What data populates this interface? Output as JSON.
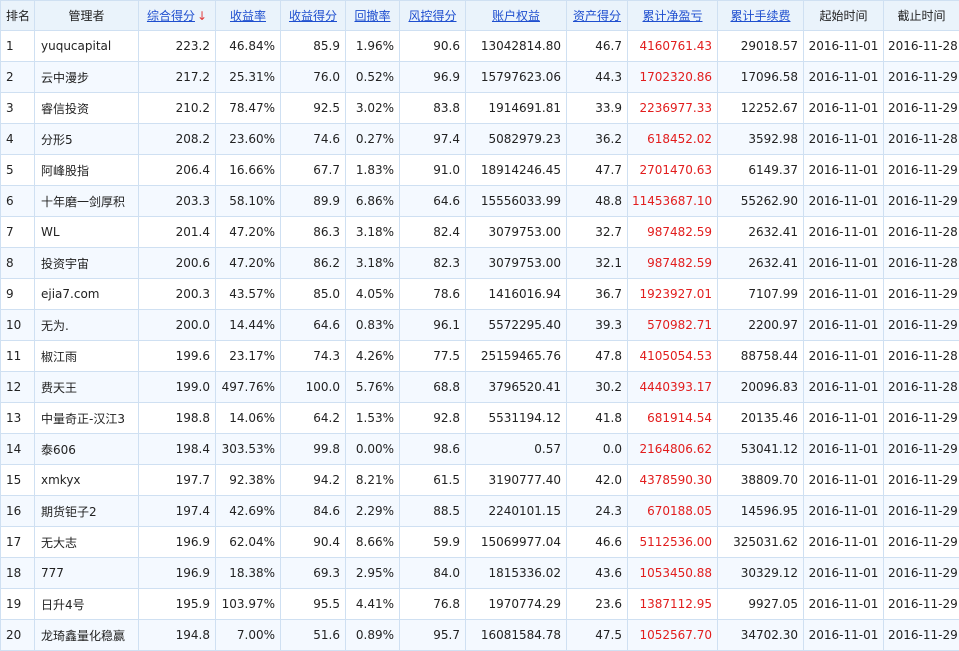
{
  "header": {
    "rank": "排名",
    "manager": "管理者",
    "composite_score": "综合得分",
    "sort_arrow": "↓",
    "return_rate": "收益率",
    "return_score": "收益得分",
    "drawdown": "回撤率",
    "risk_score": "风控得分",
    "equity": "账户权益",
    "asset_score": "资产得分",
    "cum_profit": "累计净盈亏",
    "cum_fee": "累计手续费",
    "start_time": "起始时间",
    "end_time": "截止时间"
  },
  "colors": {
    "link": "#1f4fcf",
    "profit": "#e21d1d",
    "header_bg": "#eaf3fb",
    "grid": "#cfe0f2"
  },
  "rows": [
    {
      "rank": "1",
      "manager": "yuqucapital",
      "score": "223.2",
      "ret": "46.84%",
      "ret_score": "85.9",
      "dd": "1.96%",
      "risk": "90.6",
      "equity": "13042814.80",
      "asset": "46.7",
      "profit": "4160761.43",
      "fee": "29018.57",
      "start": "2016-11-01",
      "end": "2016-11-28"
    },
    {
      "rank": "2",
      "manager": "云中漫步",
      "score": "217.2",
      "ret": "25.31%",
      "ret_score": "76.0",
      "dd": "0.52%",
      "risk": "96.9",
      "equity": "15797623.06",
      "asset": "44.3",
      "profit": "1702320.86",
      "fee": "17096.58",
      "start": "2016-11-01",
      "end": "2016-11-29"
    },
    {
      "rank": "3",
      "manager": "睿信投资",
      "score": "210.2",
      "ret": "78.47%",
      "ret_score": "92.5",
      "dd": "3.02%",
      "risk": "83.8",
      "equity": "1914691.81",
      "asset": "33.9",
      "profit": "2236977.33",
      "fee": "12252.67",
      "start": "2016-11-01",
      "end": "2016-11-29"
    },
    {
      "rank": "4",
      "manager": "分形5",
      "score": "208.2",
      "ret": "23.60%",
      "ret_score": "74.6",
      "dd": "0.27%",
      "risk": "97.4",
      "equity": "5082979.23",
      "asset": "36.2",
      "profit": "618452.02",
      "fee": "3592.98",
      "start": "2016-11-01",
      "end": "2016-11-28"
    },
    {
      "rank": "5",
      "manager": "阿峰股指",
      "score": "206.4",
      "ret": "16.66%",
      "ret_score": "67.7",
      "dd": "1.83%",
      "risk": "91.0",
      "equity": "18914246.45",
      "asset": "47.7",
      "profit": "2701470.63",
      "fee": "6149.37",
      "start": "2016-11-01",
      "end": "2016-11-29"
    },
    {
      "rank": "6",
      "manager": "十年磨一剑厚积",
      "score": "203.3",
      "ret": "58.10%",
      "ret_score": "89.9",
      "dd": "6.86%",
      "risk": "64.6",
      "equity": "15556033.99",
      "asset": "48.8",
      "profit": "11453687.10",
      "fee": "55262.90",
      "start": "2016-11-01",
      "end": "2016-11-29"
    },
    {
      "rank": "7",
      "manager": "WL",
      "score": "201.4",
      "ret": "47.20%",
      "ret_score": "86.3",
      "dd": "3.18%",
      "risk": "82.4",
      "equity": "3079753.00",
      "asset": "32.7",
      "profit": "987482.59",
      "fee": "2632.41",
      "start": "2016-11-01",
      "end": "2016-11-28"
    },
    {
      "rank": "8",
      "manager": "投资宇宙",
      "score": "200.6",
      "ret": "47.20%",
      "ret_score": "86.2",
      "dd": "3.18%",
      "risk": "82.3",
      "equity": "3079753.00",
      "asset": "32.1",
      "profit": "987482.59",
      "fee": "2632.41",
      "start": "2016-11-01",
      "end": "2016-11-28"
    },
    {
      "rank": "9",
      "manager": "ejia7.com",
      "score": "200.3",
      "ret": "43.57%",
      "ret_score": "85.0",
      "dd": "4.05%",
      "risk": "78.6",
      "equity": "1416016.94",
      "asset": "36.7",
      "profit": "1923927.01",
      "fee": "7107.99",
      "start": "2016-11-01",
      "end": "2016-11-29"
    },
    {
      "rank": "10",
      "manager": "无为.",
      "score": "200.0",
      "ret": "14.44%",
      "ret_score": "64.6",
      "dd": "0.83%",
      "risk": "96.1",
      "equity": "5572295.40",
      "asset": "39.3",
      "profit": "570982.71",
      "fee": "2200.97",
      "start": "2016-11-01",
      "end": "2016-11-29"
    },
    {
      "rank": "11",
      "manager": "椒江雨",
      "score": "199.6",
      "ret": "23.17%",
      "ret_score": "74.3",
      "dd": "4.26%",
      "risk": "77.5",
      "equity": "25159465.76",
      "asset": "47.8",
      "profit": "4105054.53",
      "fee": "88758.44",
      "start": "2016-11-01",
      "end": "2016-11-28"
    },
    {
      "rank": "12",
      "manager": "费天王",
      "score": "199.0",
      "ret": "497.76%",
      "ret_score": "100.0",
      "dd": "5.76%",
      "risk": "68.8",
      "equity": "3796520.41",
      "asset": "30.2",
      "profit": "4440393.17",
      "fee": "20096.83",
      "start": "2016-11-01",
      "end": "2016-11-28"
    },
    {
      "rank": "13",
      "manager": "中量奇正-汉江3",
      "score": "198.8",
      "ret": "14.06%",
      "ret_score": "64.2",
      "dd": "1.53%",
      "risk": "92.8",
      "equity": "5531194.12",
      "asset": "41.8",
      "profit": "681914.54",
      "fee": "20135.46",
      "start": "2016-11-01",
      "end": "2016-11-29"
    },
    {
      "rank": "14",
      "manager": "泰606",
      "score": "198.4",
      "ret": "303.53%",
      "ret_score": "99.8",
      "dd": "0.00%",
      "risk": "98.6",
      "equity": "0.57",
      "asset": "0.0",
      "profit": "2164806.62",
      "fee": "53041.12",
      "start": "2016-11-01",
      "end": "2016-11-29"
    },
    {
      "rank": "15",
      "manager": "xmkyx",
      "score": "197.7",
      "ret": "92.38%",
      "ret_score": "94.2",
      "dd": "8.21%",
      "risk": "61.5",
      "equity": "3190777.40",
      "asset": "42.0",
      "profit": "4378590.30",
      "fee": "38809.70",
      "start": "2016-11-01",
      "end": "2016-11-29"
    },
    {
      "rank": "16",
      "manager": "期货钜子2",
      "score": "197.4",
      "ret": "42.69%",
      "ret_score": "84.6",
      "dd": "2.29%",
      "risk": "88.5",
      "equity": "2240101.15",
      "asset": "24.3",
      "profit": "670188.05",
      "fee": "14596.95",
      "start": "2016-11-01",
      "end": "2016-11-29"
    },
    {
      "rank": "17",
      "manager": "无大志",
      "score": "196.9",
      "ret": "62.04%",
      "ret_score": "90.4",
      "dd": "8.66%",
      "risk": "59.9",
      "equity": "15069977.04",
      "asset": "46.6",
      "profit": "5112536.00",
      "fee": "325031.62",
      "start": "2016-11-01",
      "end": "2016-11-29"
    },
    {
      "rank": "18",
      "manager": "777",
      "score": "196.9",
      "ret": "18.38%",
      "ret_score": "69.3",
      "dd": "2.95%",
      "risk": "84.0",
      "equity": "1815336.02",
      "asset": "43.6",
      "profit": "1053450.88",
      "fee": "30329.12",
      "start": "2016-11-01",
      "end": "2016-11-29"
    },
    {
      "rank": "19",
      "manager": "日升4号",
      "score": "195.9",
      "ret": "103.97%",
      "ret_score": "95.5",
      "dd": "4.41%",
      "risk": "76.8",
      "equity": "1970774.29",
      "asset": "23.6",
      "profit": "1387112.95",
      "fee": "9927.05",
      "start": "2016-11-01",
      "end": "2016-11-29"
    },
    {
      "rank": "20",
      "manager": "龙琦鑫量化稳赢",
      "score": "194.8",
      "ret": "7.00%",
      "ret_score": "51.6",
      "dd": "0.89%",
      "risk": "95.7",
      "equity": "16081584.78",
      "asset": "47.5",
      "profit": "1052567.70",
      "fee": "34702.30",
      "start": "2016-11-01",
      "end": "2016-11-29"
    }
  ]
}
